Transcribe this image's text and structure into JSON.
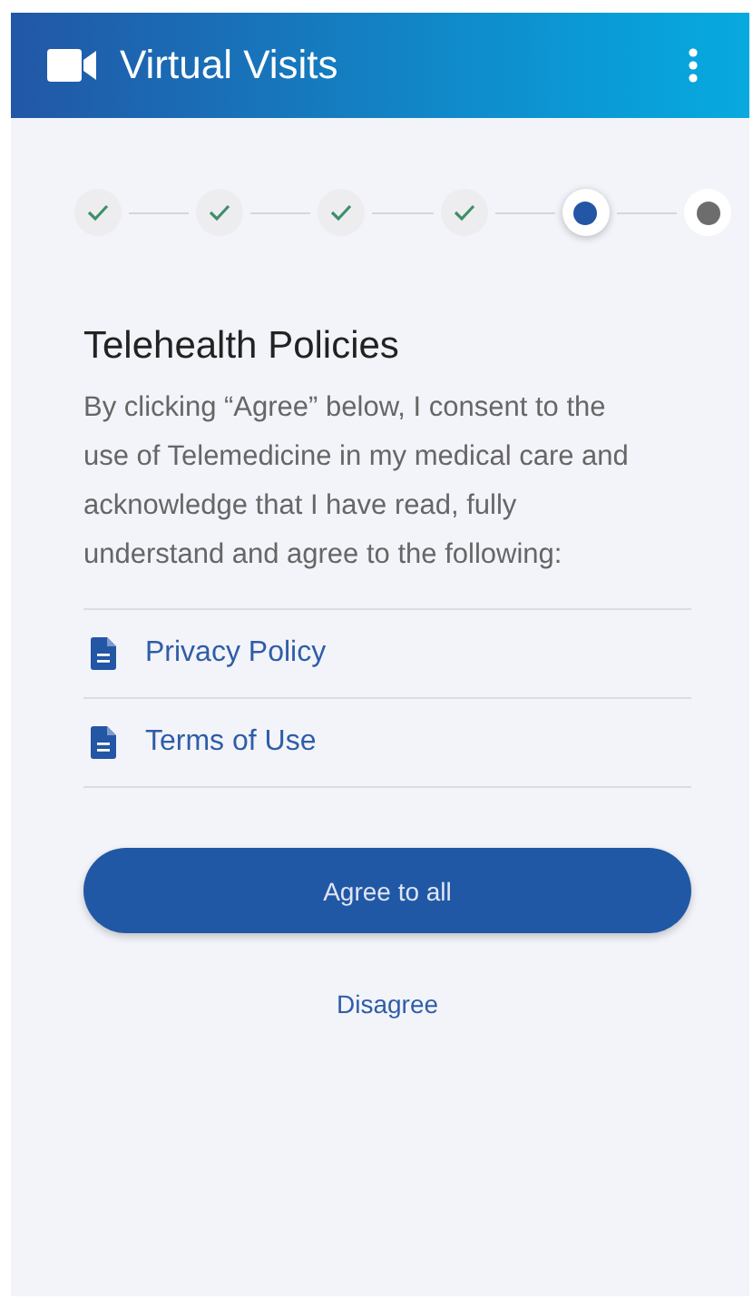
{
  "app_bar": {
    "title": "Virtual Visits"
  },
  "steps": [
    {
      "kind": "done"
    },
    {
      "kind": "done"
    },
    {
      "kind": "done"
    },
    {
      "kind": "done"
    },
    {
      "kind": "current"
    },
    {
      "kind": "upcoming"
    }
  ],
  "heading": "Telehealth Policies",
  "intro": "By clicking “Agree” below, I consent to the use of Telemedicine in my medical care and acknowledge that I have read, fully understand and agree to the following:",
  "documents": [
    {
      "label": "Privacy Policy"
    },
    {
      "label": "Terms of Use"
    }
  ],
  "primary_button": "Agree to all",
  "secondary_link": "Disagree"
}
